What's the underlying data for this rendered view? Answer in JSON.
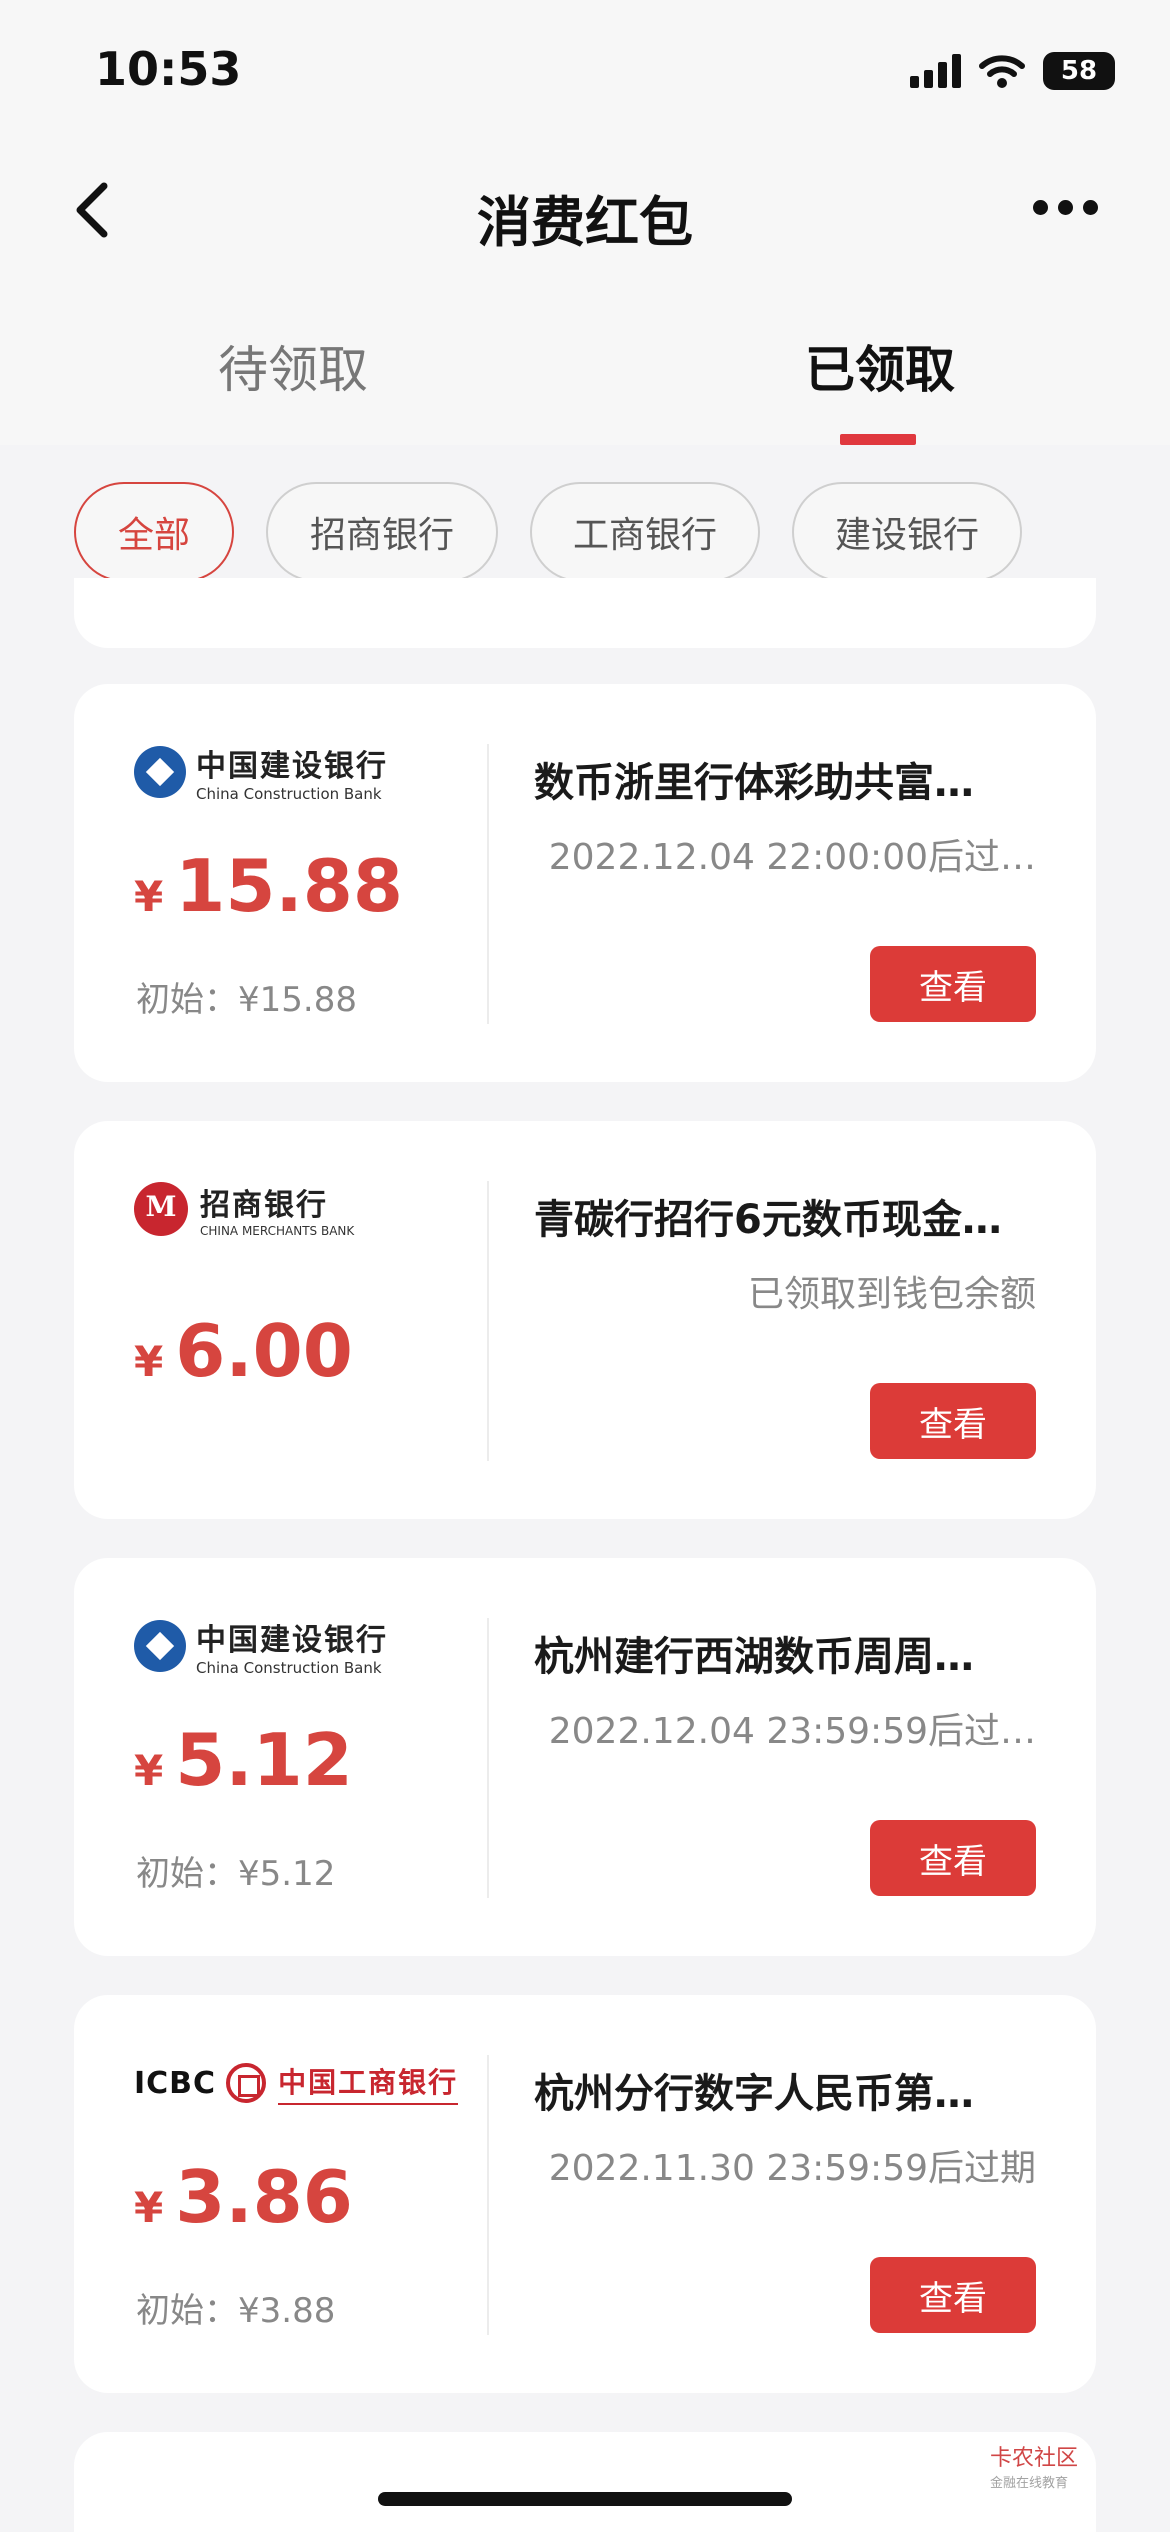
{
  "status_bar": {
    "time": "10:53",
    "battery": "58"
  },
  "nav": {
    "title": "消费红包"
  },
  "tabs": [
    {
      "label": "待领取",
      "active": false
    },
    {
      "label": "已领取",
      "active": true
    }
  ],
  "filters": [
    "全部",
    "招商银行",
    "工商银行",
    "建设银行"
  ],
  "active_filter": "全部",
  "cards": [
    {
      "bank_cn": "中国建设银行",
      "bank_en": "China Construction Bank",
      "currency": "¥",
      "amount": "15.88",
      "initial": "初始：¥15.88",
      "title": "数币浙里行体彩助共富…",
      "subtitle": "2022.12.04 22:00:00后过…",
      "button": "查看"
    },
    {
      "bank_cn": "招商银行",
      "bank_en": "CHINA MERCHANTS BANK",
      "currency": "¥",
      "amount": "6.00",
      "initial": "",
      "title": "青碳行招行6元数币现金…",
      "subtitle": "已领取到钱包余额",
      "button": "查看"
    },
    {
      "bank_cn": "中国建设银行",
      "bank_en": "China Construction Bank",
      "currency": "¥",
      "amount": "5.12",
      "initial": "初始：¥5.12",
      "title": "杭州建行西湖数币周周…",
      "subtitle": "2022.12.04 23:59:59后过…",
      "button": "查看"
    },
    {
      "bank_cn": "中国工商银行",
      "bank_en": "ICBC",
      "currency": "¥",
      "amount": "3.86",
      "initial": "初始：¥3.88",
      "title": "杭州分行数字人民币第…",
      "subtitle": "2022.11.30 23:59:59后过期",
      "button": "查看"
    }
  ],
  "watermark": {
    "text": "卡农社区",
    "sub": "金融在线教育"
  },
  "colors": {
    "accent": "#dc3b38",
    "background": "#f4f4f6"
  }
}
